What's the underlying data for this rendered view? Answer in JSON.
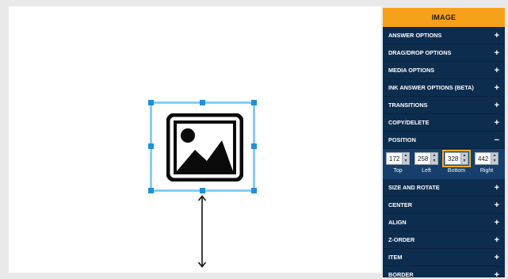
{
  "panel": {
    "title": "IMAGE",
    "sections_before": [
      {
        "label": "ANSWER OPTIONS",
        "toggle": "+"
      },
      {
        "label": "DRAG/DROP OPTIONS",
        "toggle": "+"
      },
      {
        "label": "MEDIA OPTIONS",
        "toggle": "+"
      },
      {
        "label": "INK ANSWER OPTIONS (BETA)",
        "toggle": "+"
      },
      {
        "label": "TRANSITIONS",
        "toggle": "+"
      },
      {
        "label": "COPY/DELETE",
        "toggle": "+"
      }
    ],
    "position": {
      "label": "POSITION",
      "toggle": "−",
      "fields": [
        {
          "label": "Top",
          "value": "172"
        },
        {
          "label": "Left",
          "value": "258"
        },
        {
          "label": "Bottom",
          "value": "328"
        },
        {
          "label": "Right",
          "value": "442"
        }
      ]
    },
    "sections_after": [
      {
        "label": "SIZE AND ROTATE",
        "toggle": "+"
      },
      {
        "label": "CENTER",
        "toggle": "+"
      },
      {
        "label": "ALIGN",
        "toggle": "+"
      },
      {
        "label": "Z-ORDER",
        "toggle": "+"
      },
      {
        "label": "ITEM",
        "toggle": "+"
      },
      {
        "label": "BORDER",
        "toggle": "+"
      }
    ]
  },
  "icons": {
    "image": "image-placeholder-icon",
    "arrow": "vertical-resize-arrow-icon"
  },
  "colors": {
    "header": "#f7a11a",
    "panel": "#0d2d4f",
    "selection": "#7fd1f5",
    "handle": "#1f8fd6",
    "highlight": "#f2b020"
  }
}
